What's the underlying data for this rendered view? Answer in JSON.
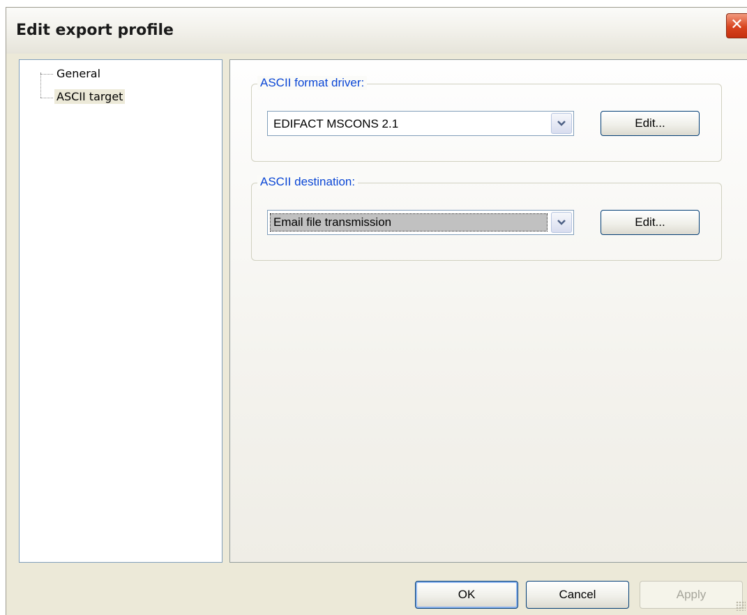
{
  "window": {
    "title": "Edit export profile",
    "close_symbol": "✕"
  },
  "tree": {
    "items": [
      {
        "label": "General",
        "selected": false
      },
      {
        "label": "ASCII target",
        "selected": true
      }
    ]
  },
  "format_group": {
    "legend": "ASCII format driver:",
    "selected_value": "EDIFACT MSCONS 2.1",
    "edit_label": "Edit..."
  },
  "destination_group": {
    "legend": "ASCII destination:",
    "selected_value": "Email file transmission",
    "edit_label": "Edit..."
  },
  "buttons": {
    "ok_label": "OK",
    "cancel_label": "Cancel",
    "apply_label": "Apply",
    "apply_enabled": false
  },
  "icons": {
    "close": "close-icon",
    "dropdown": "chevron-down-icon",
    "grip": "resize-grip-icon"
  },
  "colors": {
    "legend_text": "#0a46d5",
    "close_button": "#d9441f",
    "window_bg": "#ece9d8"
  }
}
